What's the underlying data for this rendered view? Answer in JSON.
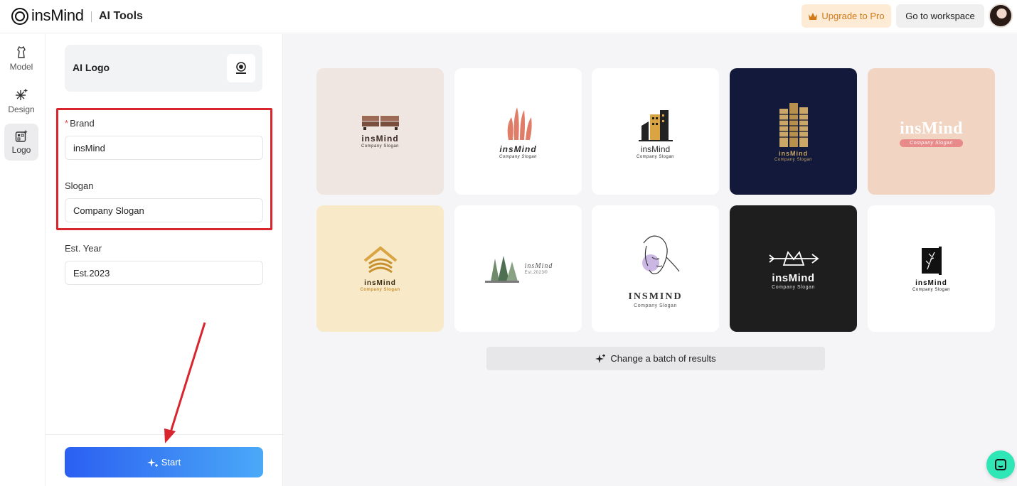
{
  "header": {
    "brand": "insMind",
    "tools_label": "AI Tools",
    "upgrade_label": "Upgrade to Pro",
    "workspace_label": "Go to workspace"
  },
  "rail": {
    "items": [
      {
        "label": "Model",
        "icon": "mannequin-icon"
      },
      {
        "label": "Design",
        "icon": "sparkle-icon"
      },
      {
        "label": "Logo",
        "icon": "logo-grid-icon",
        "active": true
      }
    ]
  },
  "panel": {
    "tool_title": "AI Logo",
    "brand_label": "Brand",
    "brand_value": "insMind",
    "slogan_label": "Slogan",
    "slogan_value": "Company Slogan",
    "year_label": "Est. Year",
    "year_value": "Est.2023",
    "start_label": "Start"
  },
  "results": {
    "tiles": [
      {
        "name": "insMind",
        "slogan": "Company Slogan",
        "bg": "#efe6e1",
        "color": "#3b2a24"
      },
      {
        "name": "insMind",
        "slogan": "Company Slogan",
        "bg": "#ffffff",
        "color": "#2b2b2b"
      },
      {
        "name": "insMind",
        "slogan": "Company Slogan",
        "bg": "#ffffff",
        "color": "#2b2b2b"
      },
      {
        "name": "insMind",
        "slogan": "Company Slogan",
        "bg": "#12193a",
        "color": "#caa766"
      },
      {
        "name": "insMind",
        "slogan": "Company Slogan",
        "bg": "#f1d4c1",
        "color": "#ffffff"
      },
      {
        "name": "insMind",
        "slogan": "Company Slogan",
        "bg": "#f8e9c9",
        "color": "#3a2a12"
      },
      {
        "name": "insMind",
        "slogan": "Est.2023®",
        "bg": "#ffffff",
        "color": "#555555"
      },
      {
        "name": "INSMIND",
        "slogan": "Company Slogan",
        "bg": "#ffffff",
        "color": "#333333"
      },
      {
        "name": "insMind",
        "slogan": "Company Slogan",
        "bg": "#1e1e1e",
        "color": "#ffffff"
      },
      {
        "name": "insMind",
        "slogan": "Company Slogan",
        "bg": "#ffffff",
        "color": "#111111"
      }
    ],
    "batch_label": "Change a batch of results"
  },
  "colors": {
    "accent_start": "#2b5ff1",
    "accent_end": "#4aa9f8",
    "highlight": "#d9252d",
    "upgrade_text": "#d07a1a",
    "chat_fab": "#2ee6b6"
  }
}
